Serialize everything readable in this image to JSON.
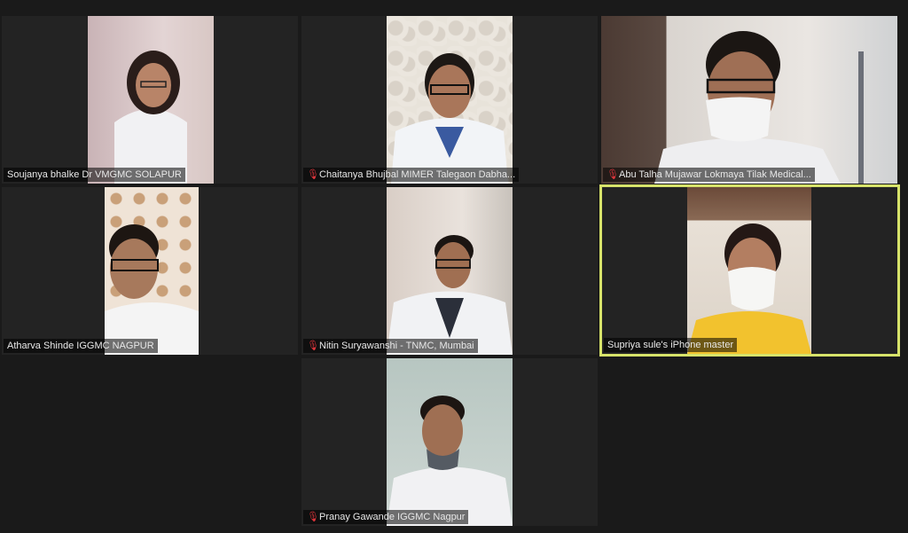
{
  "participants": [
    {
      "name": "Soujanya bhalke Dr VMGMC SOLAPUR",
      "muted": false,
      "active": false
    },
    {
      "name": "Chaitanya Bhujbal MIMER Talegaon Dabha...",
      "muted": true,
      "active": false
    },
    {
      "name": "Abu Talha Mujawar Lokmaya Tilak Medical...",
      "muted": true,
      "active": false
    },
    {
      "name": "Atharva Shinde IGGMC NAGPUR",
      "muted": false,
      "active": false
    },
    {
      "name": "Nitin Suryawanshi - TNMC, Mumbai",
      "muted": true,
      "active": false
    },
    {
      "name": "Supriya sule's iPhone master",
      "muted": false,
      "active": true
    },
    {
      "name": "Pranay Gawande IGGMC Nagpur",
      "muted": true,
      "active": false
    }
  ],
  "icons": {
    "muted": "microphone-muted-icon"
  },
  "colors": {
    "active_border": "#d7e36a",
    "muted_icon": "#e0353b",
    "background": "#1a1a1a"
  }
}
